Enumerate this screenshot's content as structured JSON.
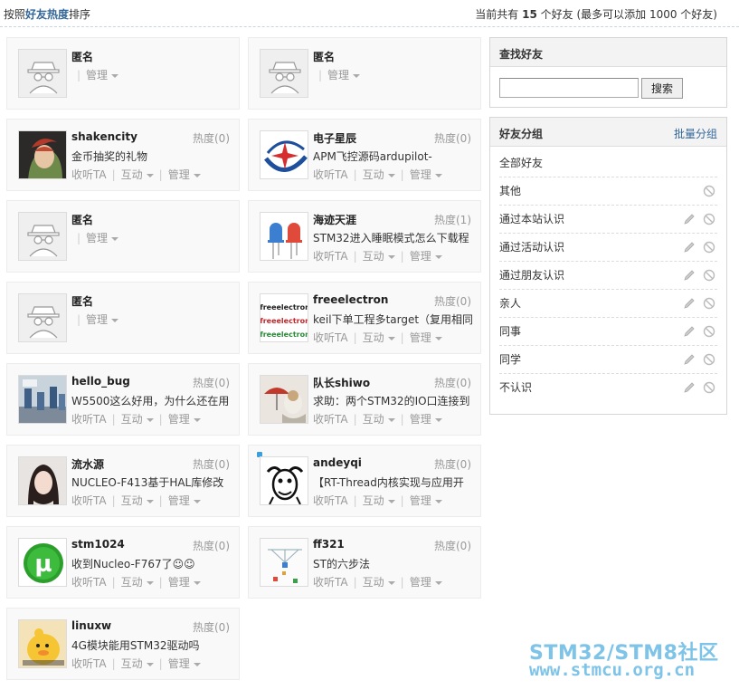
{
  "header": {
    "sort_prefix": "按照",
    "sort_key": "好友热度",
    "sort_suffix": "排序",
    "count_prefix": "当前共有",
    "count_value": "15",
    "count_suffix": "个好友 (最多可以添加 1000 个好友)"
  },
  "labels": {
    "listen": "收听TA",
    "interact": "互动",
    "manage": "管理"
  },
  "friends": [
    {
      "name": "匿名",
      "anonymous": true
    },
    {
      "name": "匿名",
      "anonymous": true
    },
    {
      "name": "shakencity",
      "heat": "热度(0)",
      "status": "金币抽奖的礼物"
    },
    {
      "name": "电子星辰",
      "heat": "热度(0)",
      "status": "APM飞控源码ardupilot-"
    },
    {
      "name": "匿名",
      "anonymous": true
    },
    {
      "name": "海迹天涯",
      "heat": "热度(1)",
      "status": "STM32进入睡眠模式怎么下载程"
    },
    {
      "name": "匿名",
      "anonymous": true
    },
    {
      "name": "freeelectron",
      "heat": "热度(0)",
      "status": "keil下单工程多target（复用相同"
    },
    {
      "name": "hello_bug",
      "heat": "热度(0)",
      "status": "W5500这么好用，为什么还在用"
    },
    {
      "name": "队长shiwo",
      "heat": "热度(0)",
      "status": "求助：两个STM32的IO口连接到"
    },
    {
      "name": "流水源",
      "heat": "热度(0)",
      "status": "NUCLEO-F413基于HAL库修改"
    },
    {
      "name": "andeyqi",
      "heat": "热度(0)",
      "status": "【RT-Thread内核实现与应用开"
    },
    {
      "name": "stm1024",
      "heat": "热度(0)",
      "status": "收到Nucleo-F767了☺☺"
    },
    {
      "name": "ff321",
      "heat": "热度(0)",
      "status": "ST的六步法"
    },
    {
      "name": "linuxw",
      "heat": "热度(0)",
      "status": "4G模块能用STM32驱动吗"
    }
  ],
  "search_panel": {
    "title": "查找好友",
    "input_value": "",
    "button_label": "搜索"
  },
  "groups_panel": {
    "title": "好友分组",
    "batch_label": "批量分组",
    "groups": [
      "全部好友",
      "其他",
      "通过本站认识",
      "通过活动认识",
      "通过朋友认识",
      "亲人",
      "同事",
      "同学",
      "不认识"
    ]
  },
  "avatar_text": {
    "freeelectron": "freeelectron",
    "stm1024": "µ"
  },
  "watermark": {
    "line1": "STM32/STM8社区",
    "line2": "www.stmcu.org.cn"
  },
  "colors": {
    "link": "#336699",
    "card_bg": "#f9f9f9",
    "watermark": "#7ec3e8"
  }
}
